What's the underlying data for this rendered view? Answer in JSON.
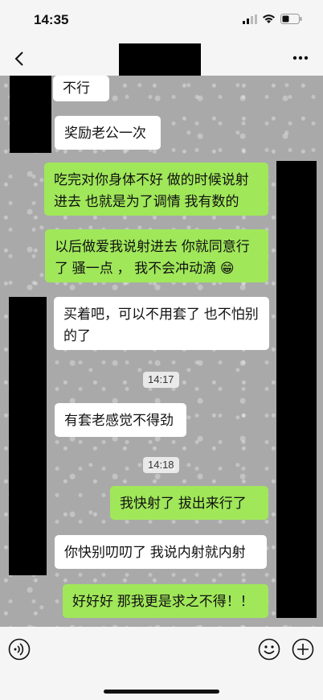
{
  "status_bar": {
    "time": "14:35"
  },
  "messages": [
    {
      "text": "不行"
    },
    {
      "text": "奖励老公一次"
    },
    {
      "text": "吃完对你身体不好 做的时候说射进去 也就是为了调情 我有数的"
    },
    {
      "text": "以后做爱我说射进去 你就同意行了 骚一点 ， 我不会冲动滴 😁"
    },
    {
      "text": "买着吧，可以不用套了 也不怕别的了"
    },
    {
      "text": "有套老感觉不得劲"
    },
    {
      "text": "我快射了  拔出来行了"
    },
    {
      "text": "你快别叨叨了  我说内射就内射"
    },
    {
      "text": "好好好  那我更是求之不得！！"
    }
  ],
  "timestamps": [
    "14:17",
    "14:18"
  ],
  "colors": {
    "bubble_green": "#a0e75a",
    "bubble_white": "#ffffff"
  }
}
